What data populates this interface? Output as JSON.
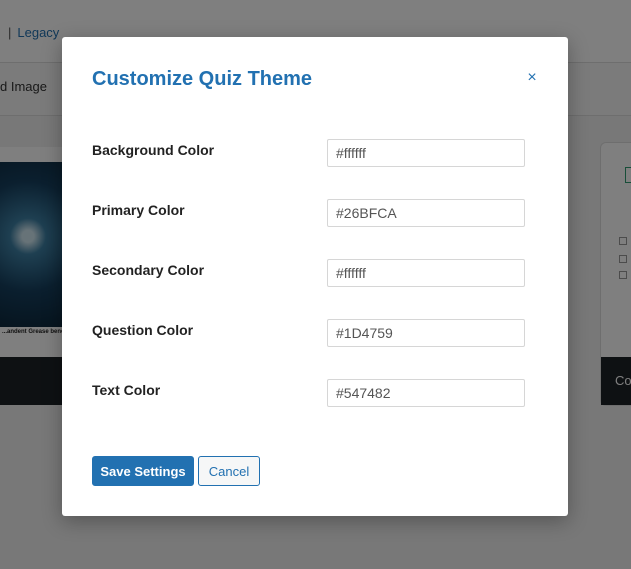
{
  "background": {
    "breadcrumb_sep": "|",
    "breadcrumb_link": "Legacy",
    "toolbar_text": "d Image",
    "left_card_caption": "...andent Grease bene...",
    "right_card_footer": "Co"
  },
  "modal": {
    "title": "Customize Quiz Theme",
    "close_symbol": "×",
    "fields": [
      {
        "label": "Background Color",
        "value": "#ffffff"
      },
      {
        "label": "Primary Color",
        "value": "#26BFCA"
      },
      {
        "label": "Secondary Color",
        "value": "#ffffff"
      },
      {
        "label": "Question Color",
        "value": "#1D4759"
      },
      {
        "label": "Text Color",
        "value": "#547482"
      }
    ],
    "save_label": "Save Settings",
    "cancel_label": "Cancel"
  },
  "colors": {
    "accent": "#2271b1",
    "overlay": "rgba(0,0,0,0.5)"
  }
}
